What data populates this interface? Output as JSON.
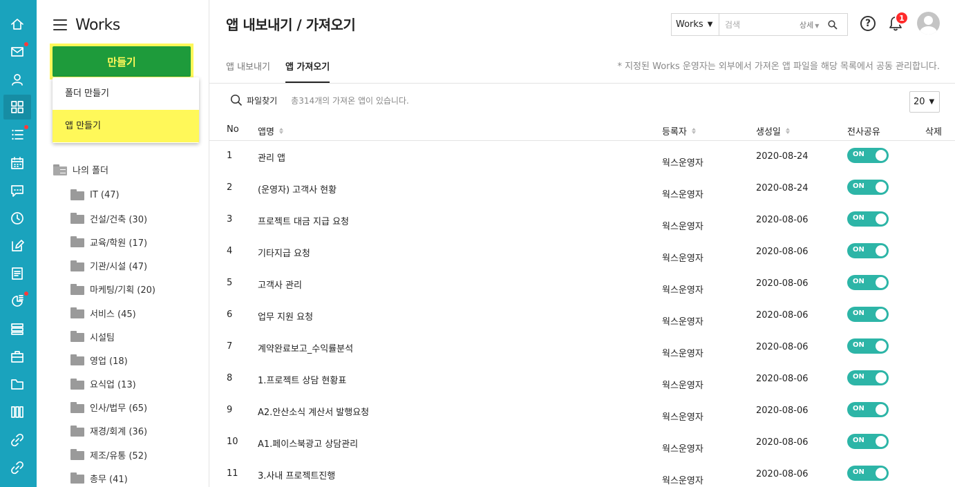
{
  "rail": {
    "items": [
      {
        "icon": "home-icon"
      },
      {
        "icon": "mail-icon",
        "dot": true
      },
      {
        "icon": "contacts-icon"
      },
      {
        "icon": "apps-icon",
        "active": true
      },
      {
        "icon": "task-list-icon",
        "dot": true
      },
      {
        "icon": "calendar-icon"
      },
      {
        "icon": "chat-icon"
      },
      {
        "icon": "clock-icon"
      },
      {
        "icon": "edit-icon"
      },
      {
        "icon": "board-icon"
      },
      {
        "icon": "report-icon",
        "dot": true
      },
      {
        "icon": "stack-icon"
      },
      {
        "icon": "briefcase-icon"
      },
      {
        "icon": "folder-icon"
      },
      {
        "icon": "library-icon"
      },
      {
        "icon": "link-icon"
      },
      {
        "icon": "link-icon"
      }
    ]
  },
  "sidebar": {
    "title": "Works",
    "create_label": "만들기",
    "menu": [
      {
        "label": "폴더 만들기"
      },
      {
        "label": "앱 만들기",
        "highlight": true
      }
    ],
    "root_folder": "나의 폴더",
    "folders": [
      "IT (47)",
      "건설/건축 (30)",
      "교육/학원 (17)",
      "기관/시설 (47)",
      "마케팅/기획 (20)",
      "서비스 (45)",
      "시설팀",
      "영업 (18)",
      "요식업 (13)",
      "인사/법무 (65)",
      "재경/회계 (36)",
      "제조/유통 (52)",
      "총무 (41)"
    ]
  },
  "header": {
    "title": "앱 내보내기 / 가져오기",
    "search_scope": "Works",
    "search_placeholder": "검색",
    "search_detail": "상세",
    "help": "?",
    "notification_count": "1"
  },
  "tabs": [
    {
      "label": "앱 내보내기",
      "active": false
    },
    {
      "label": "앱 가져오기",
      "active": true
    }
  ],
  "tab_note": "* 지정된 Works 운영자는 외부에서 가져온 앱 파일을 해당 목록에서 공동 관리합니다.",
  "toolbar": {
    "find_label": "파일찾기",
    "count_text": "총314개의 가져온 앱이 있습니다.",
    "page_size": "20"
  },
  "table": {
    "columns": {
      "no": "No",
      "name": "앱명",
      "registrant": "등록자",
      "created": "생성일",
      "share": "전사공유",
      "delete": "삭제"
    },
    "rows": [
      {
        "no": "1",
        "name": "관리 앱",
        "registrant": "웍스운영자",
        "created": "2020-08-24",
        "share": "ON"
      },
      {
        "no": "2",
        "name": "(운영자) 고객사 현황",
        "registrant": "웍스운영자",
        "created": "2020-08-24",
        "share": "ON"
      },
      {
        "no": "3",
        "name": "프로젝트 대금 지급 요청",
        "registrant": "웍스운영자",
        "created": "2020-08-06",
        "share": "ON"
      },
      {
        "no": "4",
        "name": "기타지급 요청",
        "registrant": "웍스운영자",
        "created": "2020-08-06",
        "share": "ON"
      },
      {
        "no": "5",
        "name": "고객사 관리",
        "registrant": "웍스운영자",
        "created": "2020-08-06",
        "share": "ON"
      },
      {
        "no": "6",
        "name": "업무 지원 요청",
        "registrant": "웍스운영자",
        "created": "2020-08-06",
        "share": "ON"
      },
      {
        "no": "7",
        "name": "계약완료보고_수익률분석",
        "registrant": "웍스운영자",
        "created": "2020-08-06",
        "share": "ON"
      },
      {
        "no": "8",
        "name": "1.프로젝트 상담 현황표",
        "registrant": "웍스운영자",
        "created": "2020-08-06",
        "share": "ON"
      },
      {
        "no": "9",
        "name": "A2.안산소식 계산서 발행요청",
        "registrant": "웍스운영자",
        "created": "2020-08-06",
        "share": "ON"
      },
      {
        "no": "10",
        "name": "A1.페이스북광고 상담관리",
        "registrant": "웍스운영자",
        "created": "2020-08-06",
        "share": "ON"
      },
      {
        "no": "11",
        "name": "3.사내 프로젝트진행",
        "registrant": "웍스운영자",
        "created": "2020-08-06",
        "share": "ON"
      }
    ]
  }
}
